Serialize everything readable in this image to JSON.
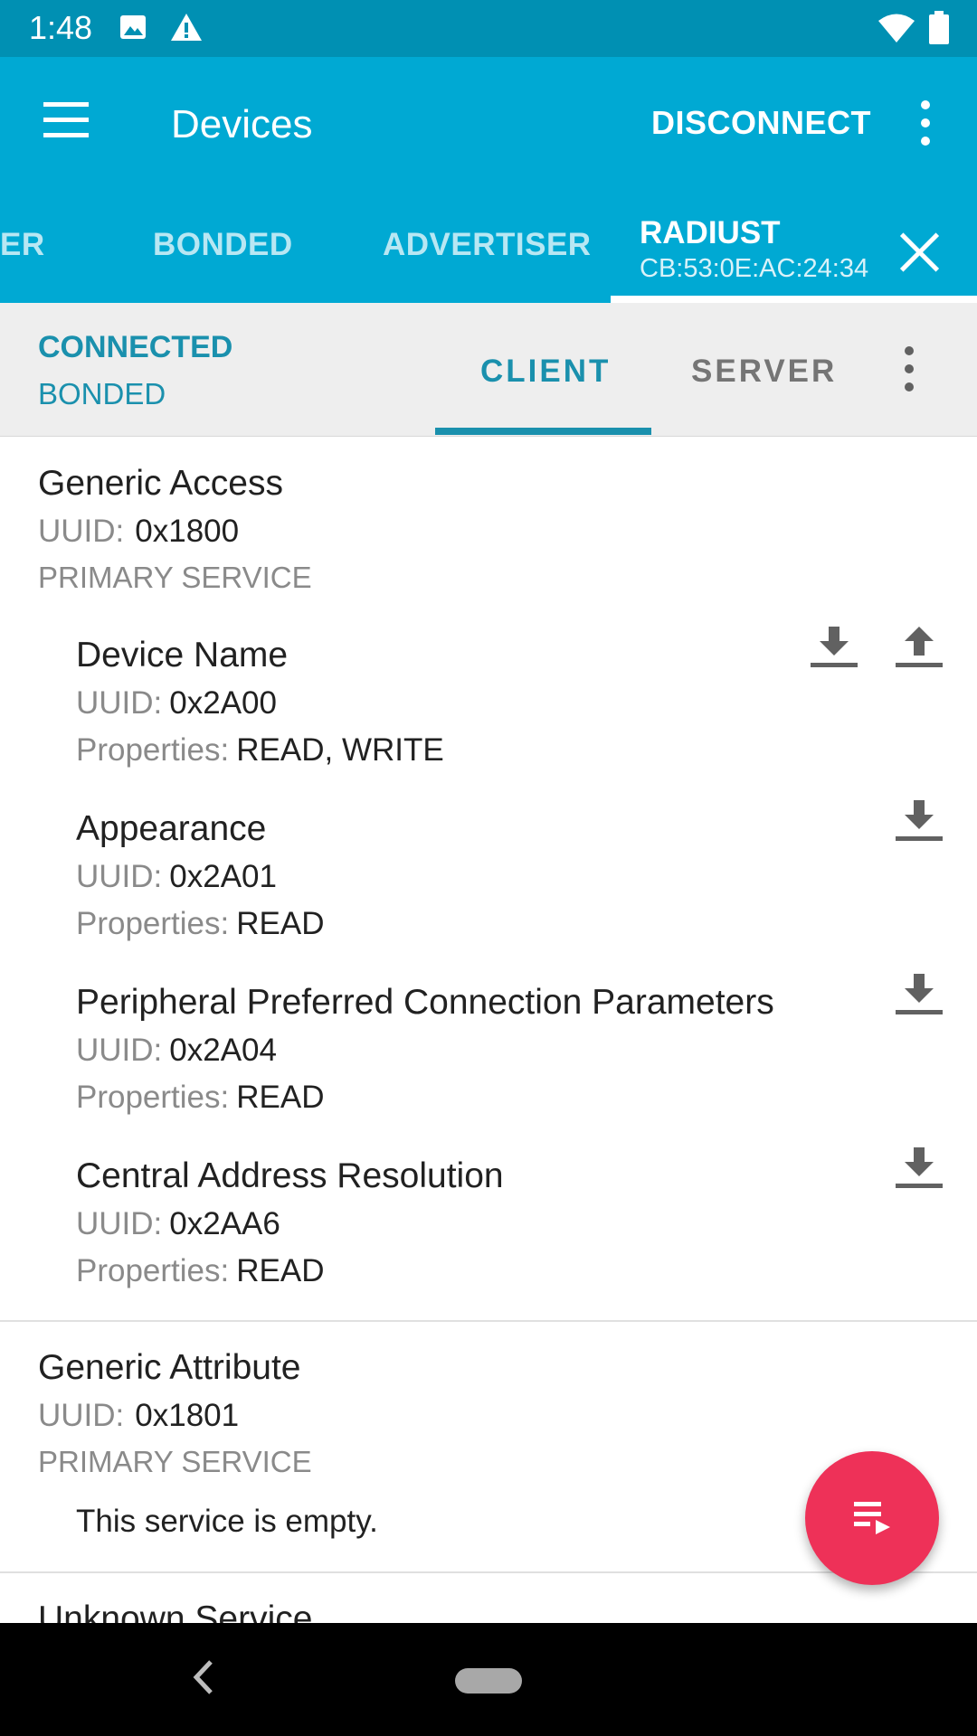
{
  "status_bar": {
    "time": "1:48"
  },
  "app_bar": {
    "title": "Devices",
    "disconnect_label": "DISCONNECT",
    "tabs": [
      {
        "label": "ER"
      },
      {
        "label": "BONDED"
      },
      {
        "label": "ADVERTISER"
      }
    ],
    "active_device": {
      "name": "RADIUST",
      "address": "CB:53:0E:AC:24:34"
    }
  },
  "sub_bar": {
    "connection_state": "CONNECTED",
    "bond_state": "BONDED",
    "tabs": [
      {
        "label": "CLIENT"
      },
      {
        "label": "SERVER"
      }
    ]
  },
  "labels": {
    "uuid": "UUID:",
    "properties": "Properties:"
  },
  "services": [
    {
      "name": "Generic Access",
      "uuid": "0x1800",
      "type": "PRIMARY SERVICE",
      "characteristics": [
        {
          "name": "Device Name",
          "uuid": "0x2A00",
          "properties": "READ, WRITE",
          "actions": [
            "download-icon",
            "upload-icon"
          ]
        },
        {
          "name": "Appearance",
          "uuid": "0x2A01",
          "properties": "READ",
          "actions": [
            "download-icon"
          ]
        },
        {
          "name": "Peripheral Preferred Connection Parameters",
          "uuid": "0x2A04",
          "properties": "READ",
          "actions": [
            "download-icon"
          ]
        },
        {
          "name": "Central Address Resolution",
          "uuid": "0x2AA6",
          "properties": "READ",
          "actions": [
            "download-icon"
          ]
        }
      ]
    },
    {
      "name": "Generic Attribute",
      "uuid": "0x1801",
      "type": "PRIMARY SERVICE",
      "empty_message": "This service is empty."
    },
    {
      "name": "Unknown Service"
    }
  ],
  "colors": {
    "app_bar": "#00a9d3",
    "status_bar": "#0090b3",
    "accent": "#1a90ad",
    "fab": "#ee3158"
  }
}
